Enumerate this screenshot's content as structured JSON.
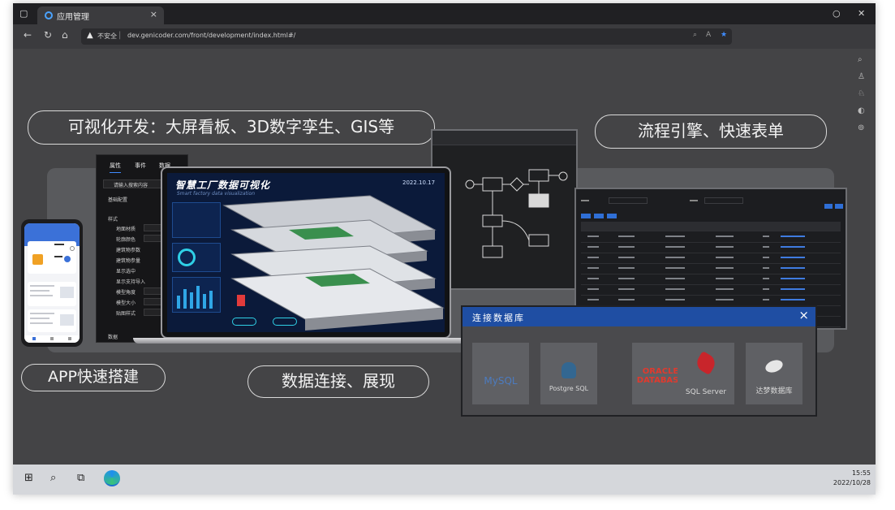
{
  "browser": {
    "tab_title": "应用管理",
    "security_label": "不安全",
    "url": "dev.genicoder.com/front/development/index.html#/",
    "window_controls": [
      "minimize-icon",
      "close-icon"
    ]
  },
  "hero": {
    "pill_visual": "可视化开发：大屏看板、3D数字孪生、GIS等",
    "pill_workflow": "流程引擎、快速表单",
    "pill_app": "APP快速搭建",
    "pill_data": "数据连接、展现"
  },
  "props_panel": {
    "tabs": [
      "属性",
      "事件",
      "数据"
    ],
    "search_placeholder": "请输入搜索内容",
    "section_basic": "基础配置",
    "section_style": "样式",
    "rows": [
      "地面材质",
      "轮廓颜色",
      "建筑物参数",
      "建筑物参量",
      "显示选中",
      "显示支持导入",
      "模型角度",
      "模型大小",
      "贴图样式"
    ],
    "footer": "数据"
  },
  "dashboard": {
    "title": "智慧工厂数据可视化",
    "subtitle": "Smart factory data visualization",
    "date": "2022.10.17"
  },
  "db_dialog": {
    "title": "连接数据库",
    "close": "×",
    "databases": [
      "MySQL",
      "Postgre SQL",
      "ORACLE DATABASE",
      "SQL Server",
      "达梦数据库"
    ]
  },
  "taskbar": {
    "time": "15:55",
    "date": "2022/10/28"
  }
}
